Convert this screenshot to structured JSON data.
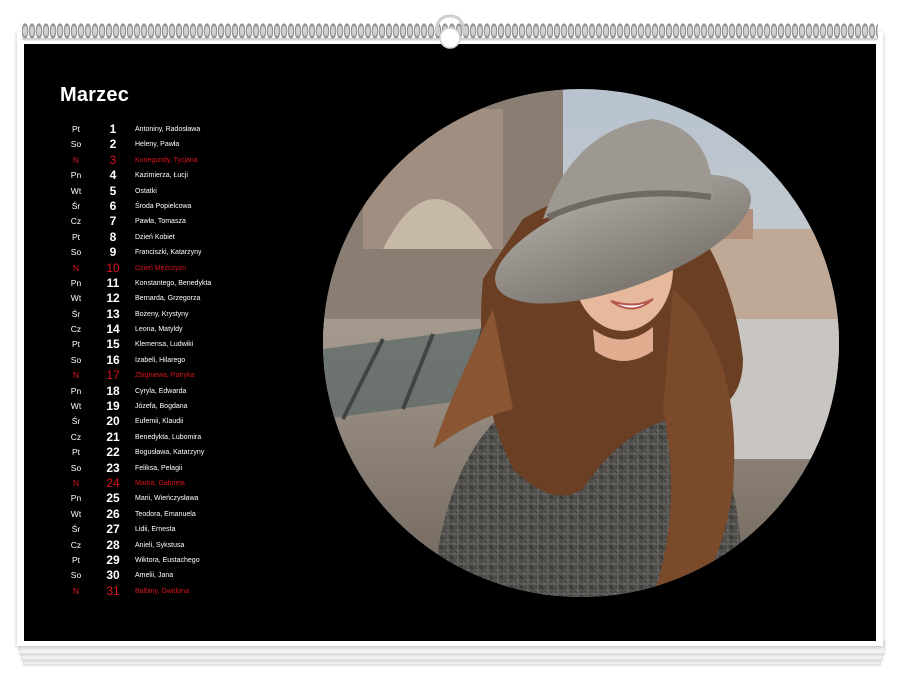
{
  "calendar": {
    "month": "Marzec",
    "days": [
      {
        "dow": "Pt",
        "num": "1",
        "names": "Antoniny, Radosława",
        "sunday": false
      },
      {
        "dow": "So",
        "num": "2",
        "names": "Heleny, Pawła",
        "sunday": false
      },
      {
        "dow": "N",
        "num": "3",
        "names": "Kunegundy, Tycjana",
        "sunday": true
      },
      {
        "dow": "Pn",
        "num": "4",
        "names": "Kazimierza, Łucji",
        "sunday": false
      },
      {
        "dow": "Wt",
        "num": "5",
        "names": "Ostatki",
        "sunday": false
      },
      {
        "dow": "Śr",
        "num": "6",
        "names": "Środa Popielcowa",
        "sunday": false
      },
      {
        "dow": "Cz",
        "num": "7",
        "names": "Pawła, Tomasza",
        "sunday": false
      },
      {
        "dow": "Pt",
        "num": "8",
        "names": "Dzień Kobiet",
        "sunday": false
      },
      {
        "dow": "So",
        "num": "9",
        "names": "Franciszki, Katarzyny",
        "sunday": false
      },
      {
        "dow": "N",
        "num": "10",
        "names": "Dzień Mężczyzn",
        "sunday": true
      },
      {
        "dow": "Pn",
        "num": "11",
        "names": "Konstantego, Benedykta",
        "sunday": false
      },
      {
        "dow": "Wt",
        "num": "12",
        "names": "Bernarda, Grzegorza",
        "sunday": false
      },
      {
        "dow": "Śr",
        "num": "13",
        "names": "Bożeny, Krystyny",
        "sunday": false
      },
      {
        "dow": "Cz",
        "num": "14",
        "names": "Leona, Matyldy",
        "sunday": false
      },
      {
        "dow": "Pt",
        "num": "15",
        "names": "Klemensa, Ludwiki",
        "sunday": false
      },
      {
        "dow": "So",
        "num": "16",
        "names": "Izabeli, Hilarego",
        "sunday": false
      },
      {
        "dow": "N",
        "num": "17",
        "names": "Zbigniewa, Patryka",
        "sunday": true
      },
      {
        "dow": "Pn",
        "num": "18",
        "names": "Cyryla, Edwarda",
        "sunday": false
      },
      {
        "dow": "Wt",
        "num": "19",
        "names": "Józefa, Bogdana",
        "sunday": false
      },
      {
        "dow": "Śr",
        "num": "20",
        "names": "Eufemii, Klaudii",
        "sunday": false
      },
      {
        "dow": "Cz",
        "num": "21",
        "names": "Benedykta, Lubomira",
        "sunday": false
      },
      {
        "dow": "Pt",
        "num": "22",
        "names": "Bogusława, Katarzyny",
        "sunday": false
      },
      {
        "dow": "So",
        "num": "23",
        "names": "Feliksa, Pelagii",
        "sunday": false
      },
      {
        "dow": "N",
        "num": "24",
        "names": "Marka, Gabriela",
        "sunday": true
      },
      {
        "dow": "Pn",
        "num": "25",
        "names": "Marii, Wieńczysława",
        "sunday": false
      },
      {
        "dow": "Wt",
        "num": "26",
        "names": "Teodora, Emanuela",
        "sunday": false
      },
      {
        "dow": "Śr",
        "num": "27",
        "names": "Lidii, Ernesta",
        "sunday": false
      },
      {
        "dow": "Cz",
        "num": "28",
        "names": "Anieli, Sykstusa",
        "sunday": false
      },
      {
        "dow": "Pt",
        "num": "29",
        "names": "Wiktora, Eustachego",
        "sunday": false
      },
      {
        "dow": "So",
        "num": "30",
        "names": "Amelii, Jana",
        "sunday": false
      },
      {
        "dow": "N",
        "num": "31",
        "names": "Balbiny, Gwidona",
        "sunday": true
      }
    ]
  },
  "colors": {
    "page_background": "#000000",
    "text": "#ffffff",
    "sunday_accent": "#d9151e"
  },
  "photo": {
    "shape": "circle",
    "subject": "smiling woman in grey hat and plaid coat"
  }
}
